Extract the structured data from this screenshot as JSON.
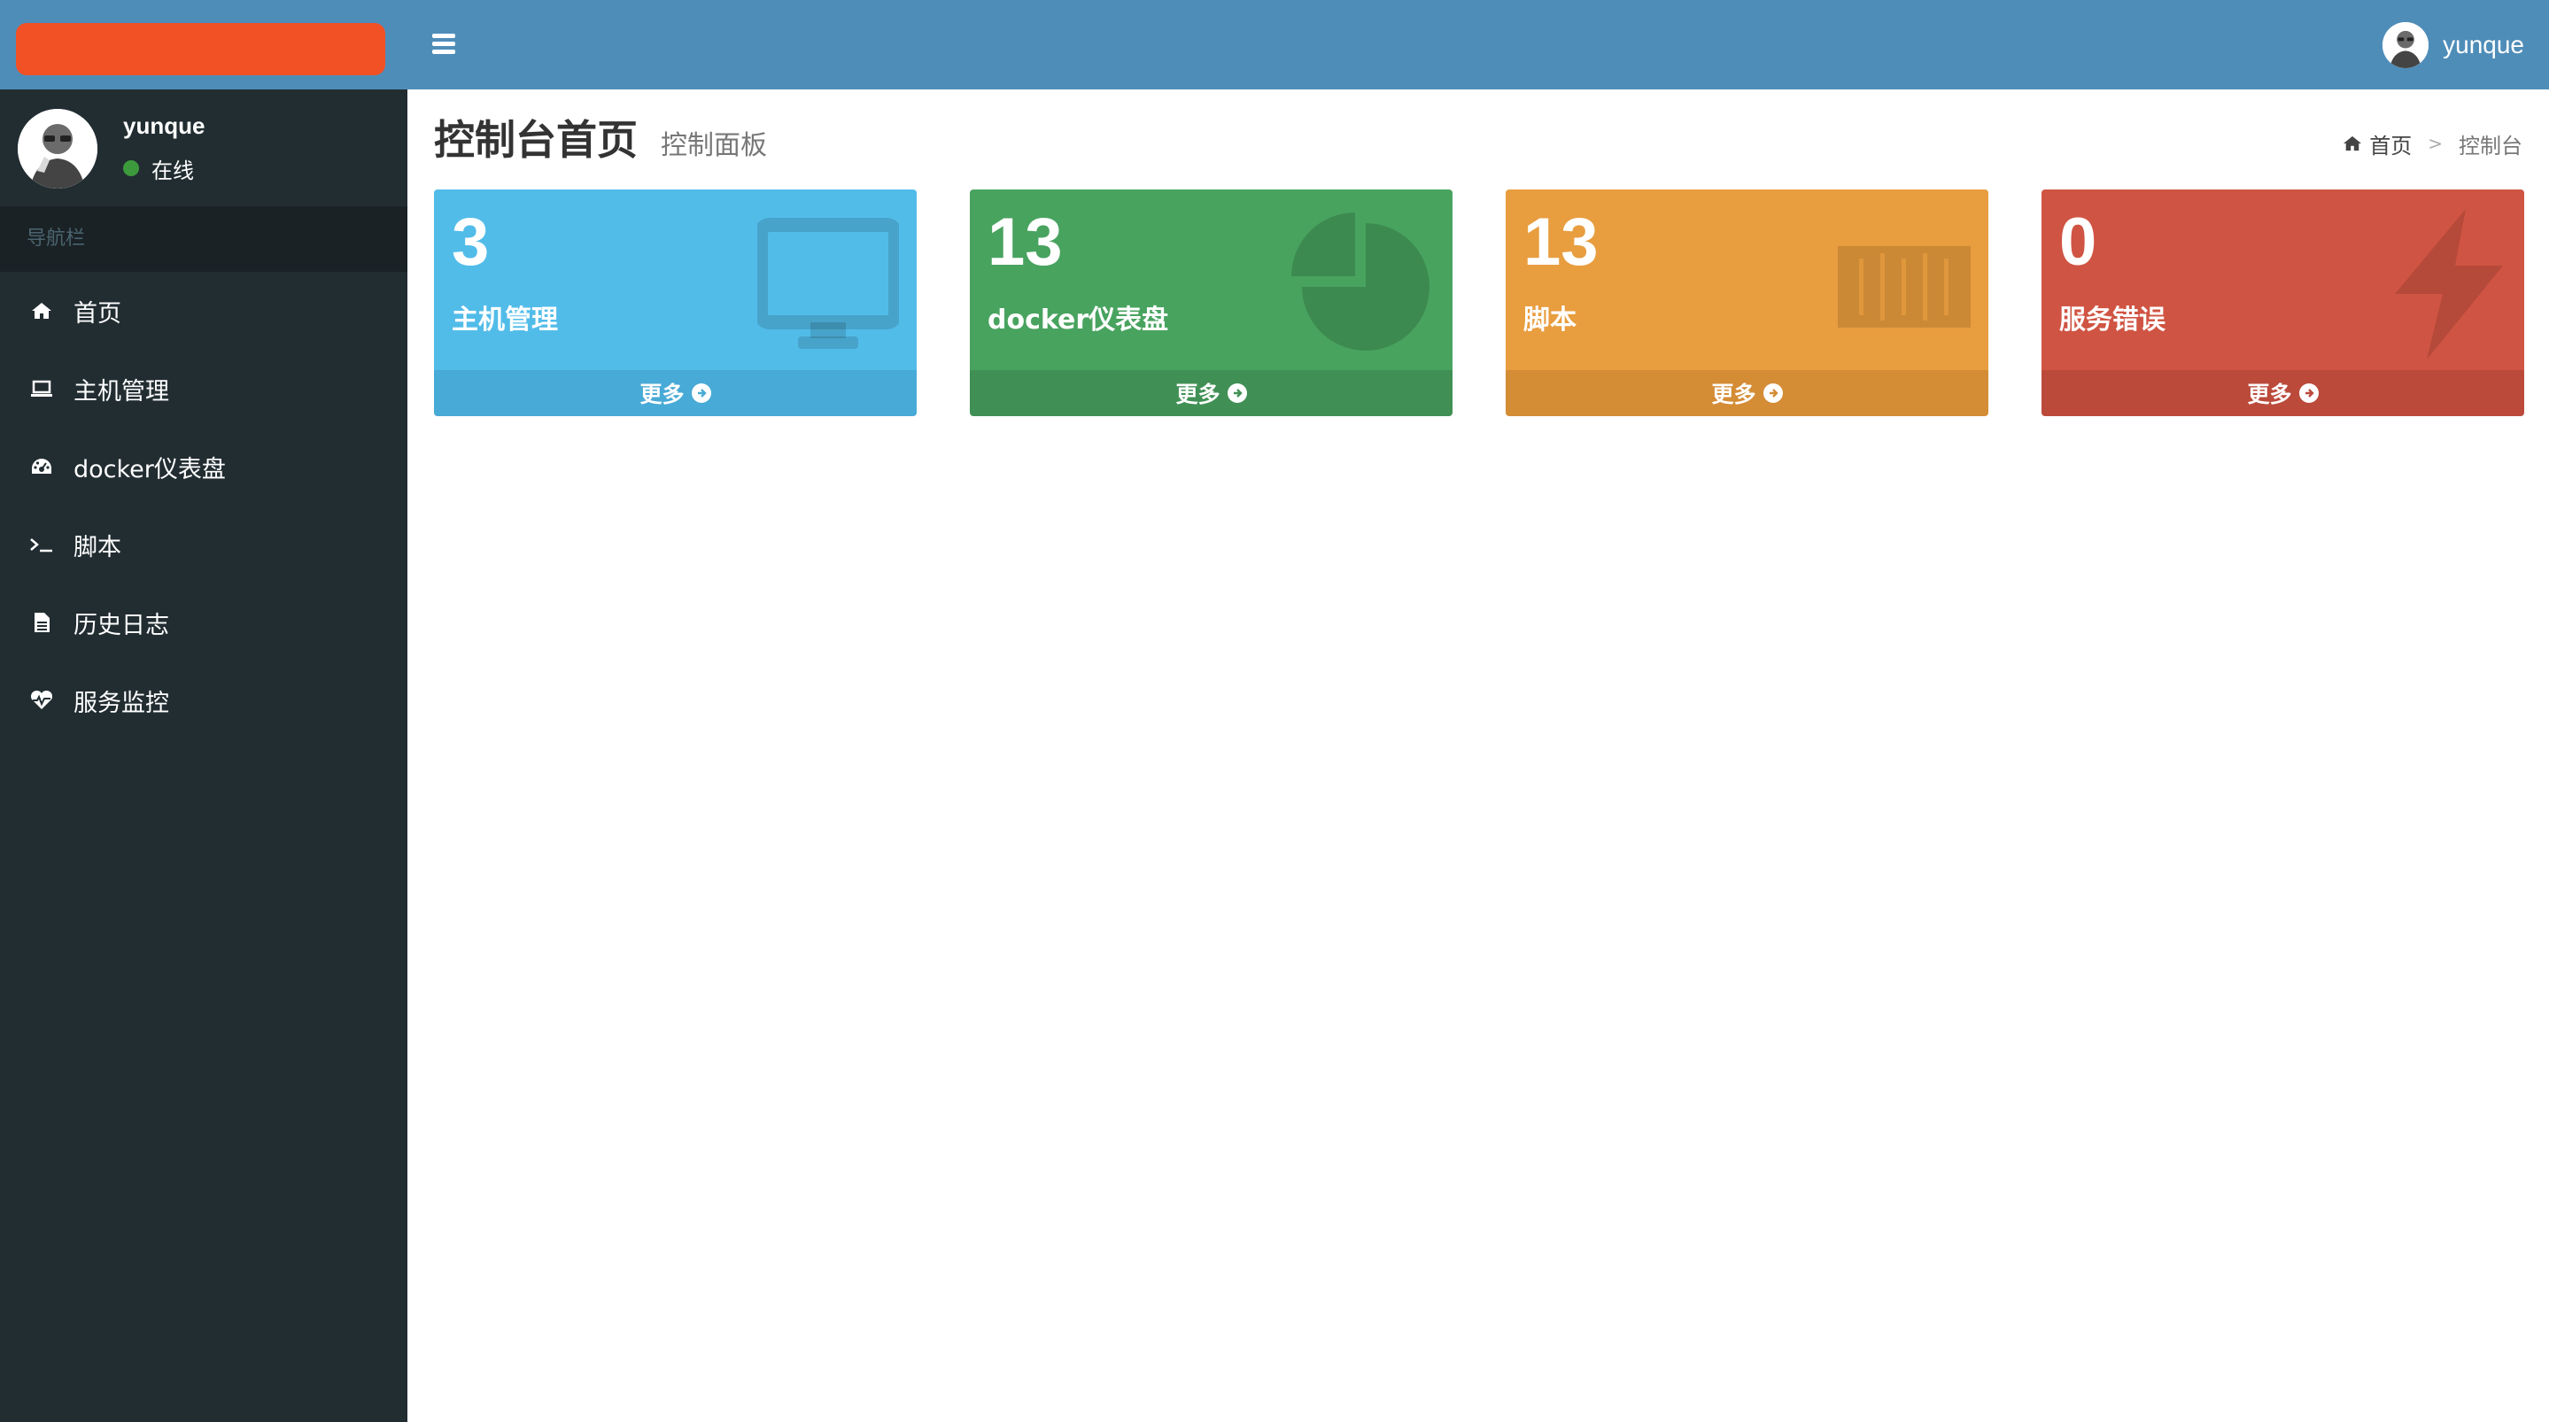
{
  "topbar": {
    "username": "yunque"
  },
  "user_panel": {
    "name": "yunque",
    "status": "在线"
  },
  "sidebar": {
    "header": "导航栏",
    "items": [
      {
        "label": "首页",
        "icon": "home-icon"
      },
      {
        "label": "主机管理",
        "icon": "laptop-icon"
      },
      {
        "label": "docker仪表盘",
        "icon": "dashboard-icon"
      },
      {
        "label": "脚本",
        "icon": "terminal-icon"
      },
      {
        "label": "历史日志",
        "icon": "file-icon"
      },
      {
        "label": "服务监控",
        "icon": "heartbeat-icon"
      }
    ]
  },
  "content": {
    "title": "控制台首页",
    "subtitle": "控制面板"
  },
  "breadcrumb": {
    "home": "首页",
    "separator": ">",
    "current": "控制台"
  },
  "boxes": [
    {
      "value": "3",
      "label": "主机管理",
      "more": "更多",
      "color": "#52bce9",
      "footer_color": "#48aad6",
      "icon": "desktop-icon"
    },
    {
      "value": "13",
      "label": "docker仪表盘",
      "more": "更多",
      "color": "#48a35f",
      "footer_color": "#409055",
      "icon": "pie-chart-icon"
    },
    {
      "value": "13",
      "label": "脚本",
      "more": "更多",
      "color": "#e89d3e",
      "footer_color": "#d48c35",
      "icon": "barcode-icon"
    },
    {
      "value": "0",
      "label": "服务错误",
      "more": "更多",
      "color": "#d05443",
      "footer_color": "#bb4a3b",
      "icon": "bolt-icon"
    }
  ]
}
